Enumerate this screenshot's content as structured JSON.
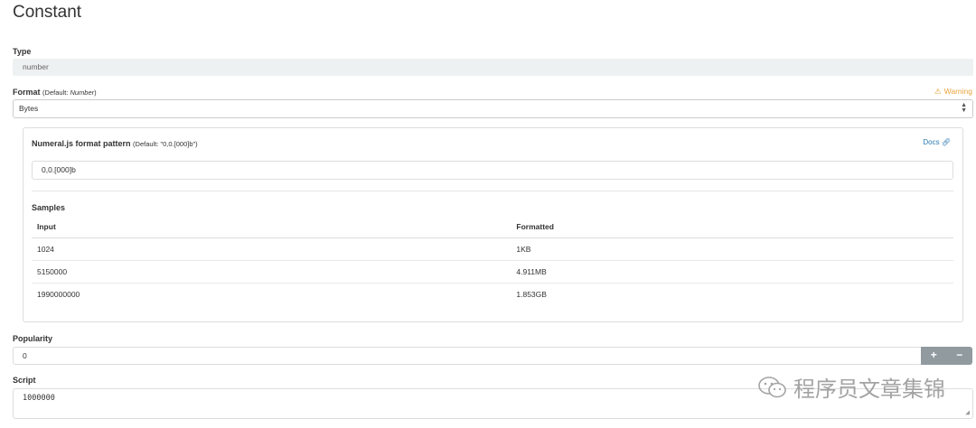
{
  "page": {
    "title": "Constant"
  },
  "type_field": {
    "label": "Type",
    "value": "number"
  },
  "format_field": {
    "label": "Format",
    "default_prefix": "(Default: ",
    "default_value": "Number",
    "default_suffix": ")",
    "warning": "Warning",
    "selected": "Bytes"
  },
  "numeral": {
    "label": "Numeral.js format pattern",
    "default_hint": "(Default: \"0,0.[000]b\")",
    "docs": "Docs",
    "value": "0,0.[000]b",
    "samples_label": "Samples",
    "columns": [
      "Input",
      "Formatted"
    ],
    "rows": [
      [
        "1024",
        "1KB"
      ],
      [
        "5150000",
        "4.911MB"
      ],
      [
        "1990000000",
        "1.853GB"
      ]
    ]
  },
  "popularity": {
    "label": "Popularity",
    "value": "0",
    "plus": "+",
    "minus": "−"
  },
  "script": {
    "label": "Script",
    "value": "1000000"
  },
  "watermark": {
    "text": "程序员文章集锦"
  },
  "colors": {
    "warning": "#e8a33c",
    "link": "#2a7ab0",
    "button_bg": "#909a9f"
  }
}
